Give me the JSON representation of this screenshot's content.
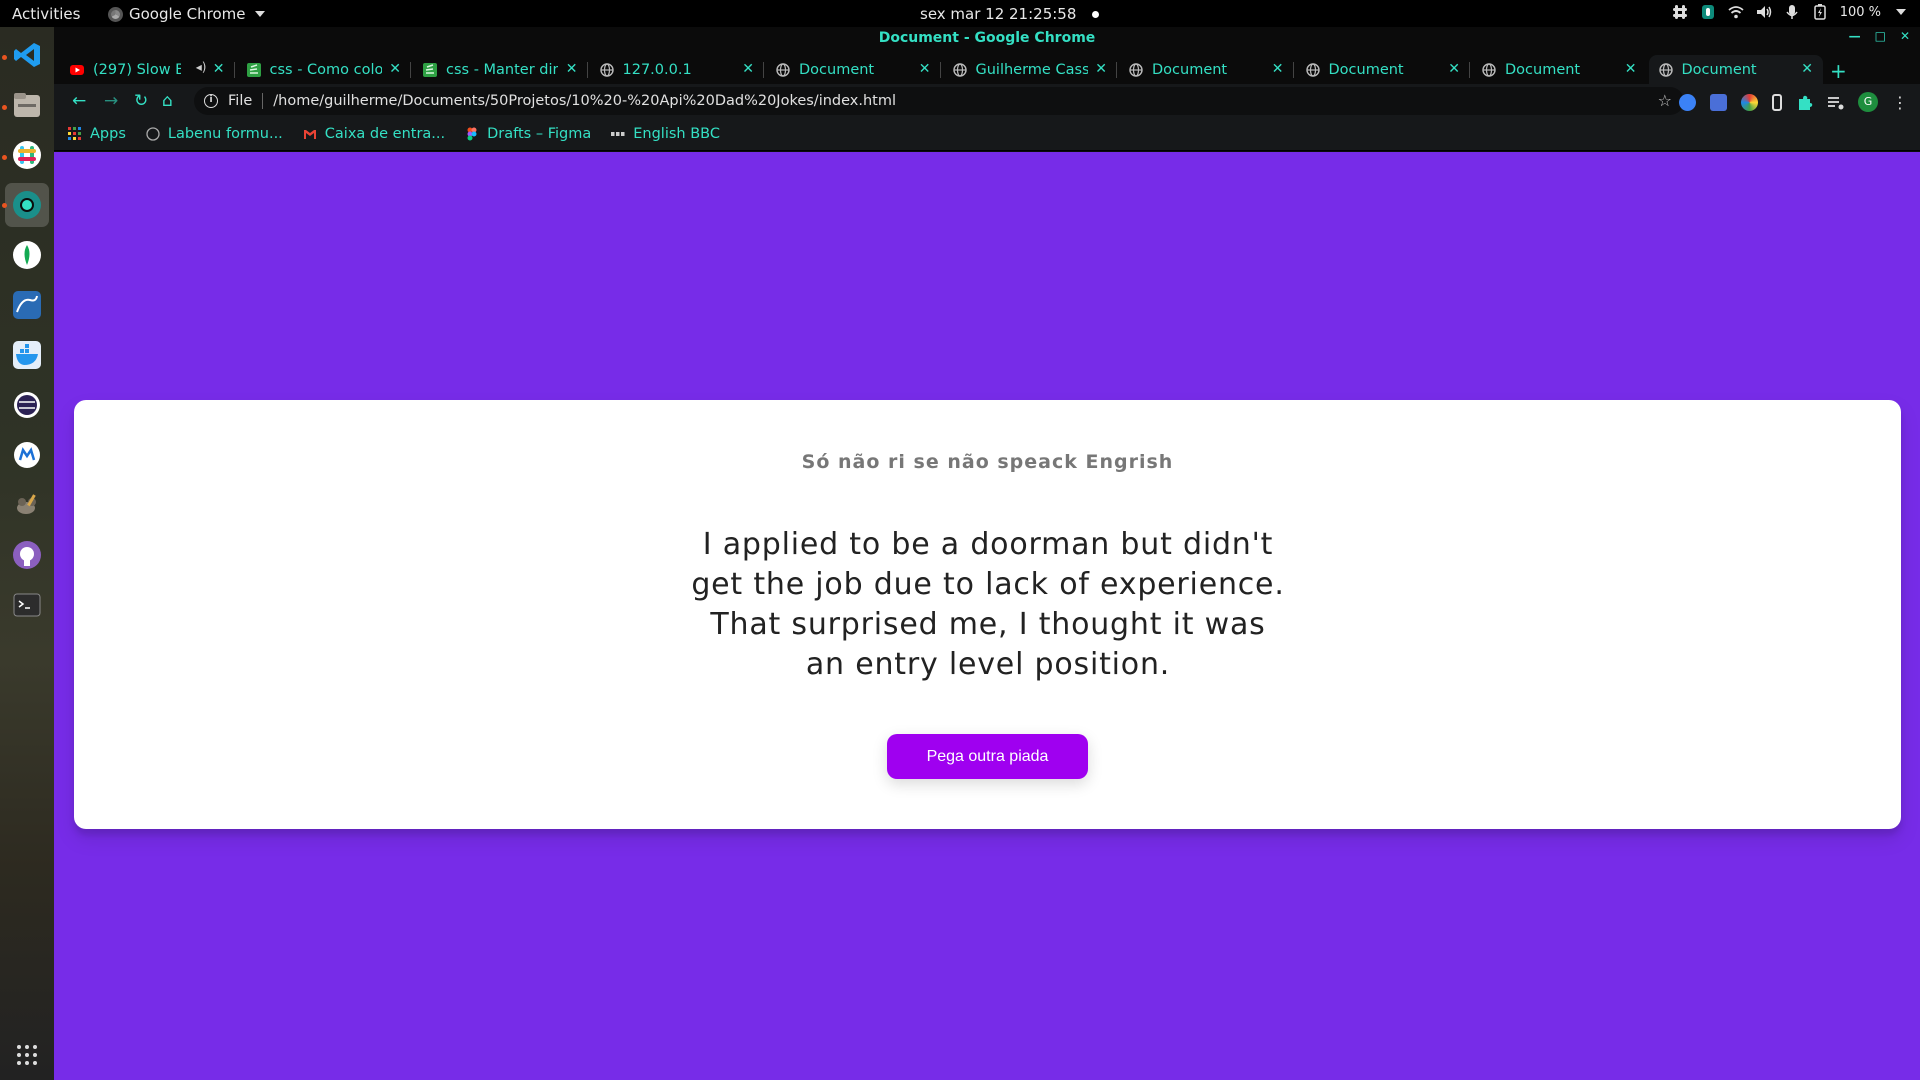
{
  "topbar": {
    "activities": "Activities",
    "app_name": "Google Chrome",
    "clock": "sex mar 12  21:25:58",
    "battery": "100 %"
  },
  "window": {
    "title": "Document - Google Chrome"
  },
  "tabs": [
    {
      "title": "(297) Slow Bl",
      "favicon": "youtube-icon"
    },
    {
      "title": "css - Como coloc",
      "favicon": "stackoverflow-icon"
    },
    {
      "title": "css - Manter dim",
      "favicon": "stackoverflow-icon"
    },
    {
      "title": "127.0.0.1",
      "favicon": "globe-icon"
    },
    {
      "title": "Document",
      "favicon": "globe-icon"
    },
    {
      "title": "Guilherme Casse",
      "favicon": "globe-icon"
    },
    {
      "title": "Document",
      "favicon": "globe-icon"
    },
    {
      "title": "Document",
      "favicon": "globe-icon"
    },
    {
      "title": "Document",
      "favicon": "globe-icon"
    },
    {
      "title": "Document",
      "favicon": "globe-icon"
    }
  ],
  "active_tab_index": 9,
  "omnibox": {
    "scheme": "File",
    "url": "/home/guilherme/Documents/50Projetos/10%20-%20Api%20Dad%20Jokes/index.html"
  },
  "bookmarks": [
    {
      "label": "Apps",
      "icon": "apps-grid-icon"
    },
    {
      "label": "Labenu formu...",
      "icon": "circle-icon"
    },
    {
      "label": "Caixa de entra...",
      "icon": "gmail-icon"
    },
    {
      "label": "Drafts – Figma",
      "icon": "figma-icon"
    },
    {
      "label": "English BBC",
      "icon": "bbc-icon"
    }
  ],
  "page": {
    "heading": "Só não ri se não speack Engrish",
    "joke": "I applied to be a doorman but didn't get the job due to lack of experience. That surprised me, I thought it was an entry level position.",
    "button_label": "Pega outra piada"
  },
  "colors": {
    "page_background": "#772ce8",
    "button": "#9f00f0",
    "chrome_accent": "#34e0c4"
  }
}
